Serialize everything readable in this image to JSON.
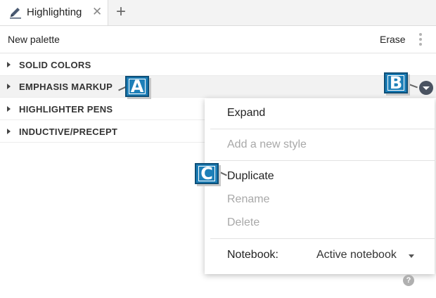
{
  "tab": {
    "label": "Highlighting",
    "close": "✕",
    "add": "+"
  },
  "toolbar": {
    "palette_name": "New palette",
    "erase": "Erase"
  },
  "groups": [
    {
      "label": "SOLID COLORS"
    },
    {
      "label": "EMPHASIS MARKUP"
    },
    {
      "label": "HIGHLIGHTER PENS"
    },
    {
      "label": "INDUCTIVE/PRECEPT"
    }
  ],
  "callouts": {
    "a": "A",
    "b": "B",
    "c": "C"
  },
  "menu": {
    "expand": "Expand",
    "add_style": "Add a new style",
    "duplicate": "Duplicate",
    "rename": "Rename",
    "delete": "Delete",
    "notebook_label": "Notebook:",
    "notebook_value": "Active notebook"
  },
  "help": "?",
  "colors": {
    "callout": "#1d7fb8",
    "toggle": "#4a5361"
  },
  "icons": [
    "pencil-icon",
    "close-icon",
    "plus-icon",
    "kebab-icon",
    "caret-right-icon",
    "chevron-down-icon",
    "help-icon"
  ]
}
